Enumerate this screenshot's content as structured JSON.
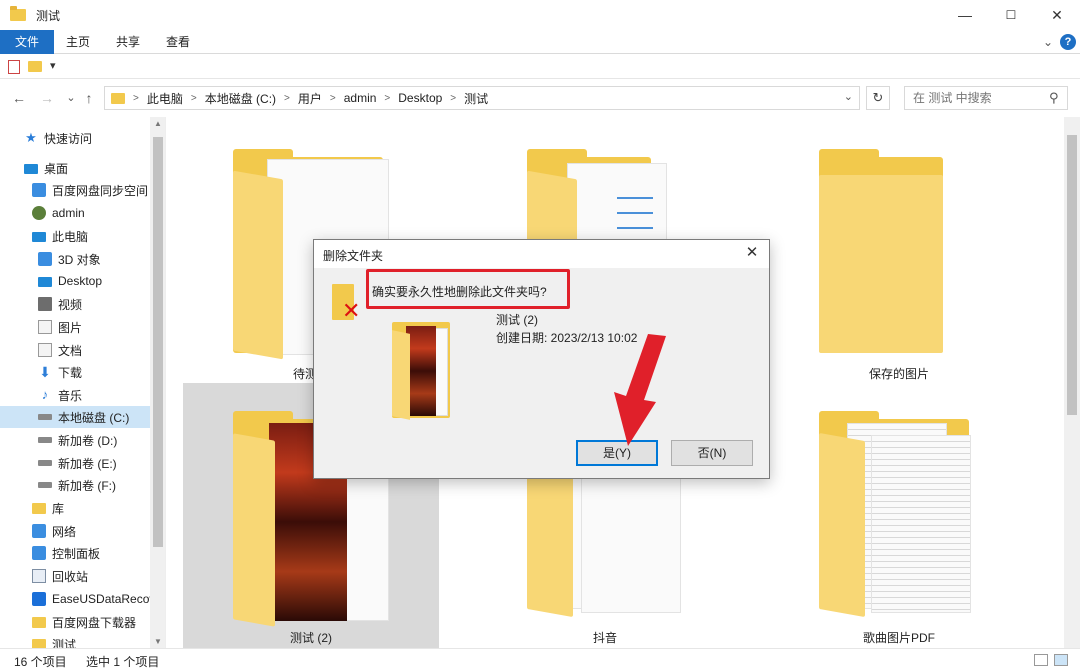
{
  "window": {
    "title": "测试",
    "controls": {
      "minimize": "—",
      "maximize": "☐",
      "close": "✕"
    }
  },
  "ribbon": {
    "tabs": [
      "文件",
      "主页",
      "共享",
      "查看"
    ],
    "expand": "⌄",
    "help": "?"
  },
  "quick_access": {
    "dropdown": "▾"
  },
  "nav": {
    "back": "←",
    "forward": "→",
    "recent": "⌄",
    "up": "↑",
    "breadcrumb": [
      "此电脑",
      "本地磁盘 (C:)",
      "用户",
      "admin",
      "Desktop",
      "测试"
    ],
    "breadcrumb_sep": ">",
    "address_dropdown": "⌄",
    "refresh": "↻",
    "search_placeholder": "在 测试 中搜索",
    "search_icon": "⚲"
  },
  "sidebar": {
    "items": [
      {
        "label": "快速访问",
        "icon": "star-icon"
      },
      {
        "label": "桌面",
        "icon": "desktop-icon"
      },
      {
        "label": "百度网盘同步空间",
        "icon": "cloud-icon"
      },
      {
        "label": "admin",
        "icon": "user-icon"
      },
      {
        "label": "此电脑",
        "icon": "computer-icon"
      },
      {
        "label": "3D 对象",
        "icon": "cube-icon"
      },
      {
        "label": "Desktop",
        "icon": "desktop-icon"
      },
      {
        "label": "视频",
        "icon": "video-icon"
      },
      {
        "label": "图片",
        "icon": "picture-icon"
      },
      {
        "label": "文档",
        "icon": "document-icon"
      },
      {
        "label": "下载",
        "icon": "download-icon"
      },
      {
        "label": "音乐",
        "icon": "music-icon"
      },
      {
        "label": "本地磁盘 (C:)",
        "icon": "drive-icon"
      },
      {
        "label": "新加卷 (D:)",
        "icon": "drive-icon"
      },
      {
        "label": "新加卷 (E:)",
        "icon": "drive-icon"
      },
      {
        "label": "新加卷 (F:)",
        "icon": "drive-icon"
      },
      {
        "label": "库",
        "icon": "library-icon"
      },
      {
        "label": "网络",
        "icon": "network-icon"
      },
      {
        "label": "控制面板",
        "icon": "control-panel-icon"
      },
      {
        "label": "回收站",
        "icon": "recycle-bin-icon"
      },
      {
        "label": "EaseUSDataRecov",
        "icon": "easeus-icon"
      },
      {
        "label": "百度网盘下载器",
        "icon": "folder-icon"
      },
      {
        "label": "测试",
        "icon": "folder-icon"
      }
    ],
    "selected_index": 12
  },
  "content": {
    "items": [
      {
        "label": "待测试"
      },
      {
        "label": ""
      },
      {
        "label": "保存的图片"
      },
      {
        "label": "测试 (2)"
      },
      {
        "label": "抖音"
      },
      {
        "label": "歌曲图片PDF"
      }
    ]
  },
  "status": {
    "count": "16 个项目",
    "selected": "选中 1 个项目"
  },
  "dialog": {
    "title": "删除文件夹",
    "close": "✕",
    "question": "确实要永久性地删除此文件夹吗?",
    "item_name": "测试 (2)",
    "item_date": "创建日期: 2023/2/13 10:02",
    "yes_label": "是(Y)",
    "no_label": "否(N)"
  },
  "colors": {
    "accent": "#1e6fc4",
    "highlight": "#e0202a",
    "folder": "#f2c94c"
  }
}
